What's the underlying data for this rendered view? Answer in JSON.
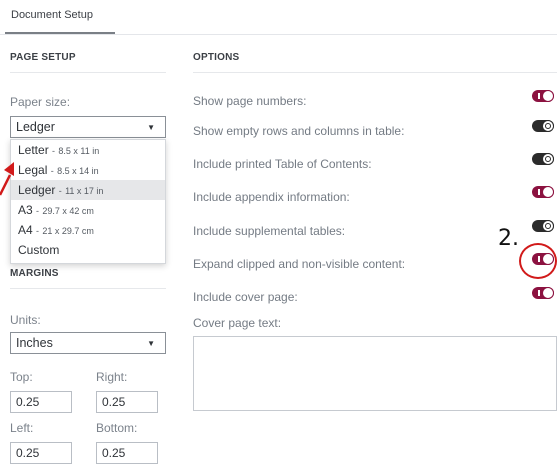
{
  "tabs": {
    "document_setup": "Document Setup"
  },
  "page_setup": {
    "heading": "PAGE SETUP",
    "paper_size_label": "Paper size:",
    "paper_size_value": "Ledger",
    "paper_options": [
      {
        "name": "Letter",
        "dims": "8.5 x 11 in"
      },
      {
        "name": "Legal",
        "dims": "8.5 x 14 in"
      },
      {
        "name": "Ledger",
        "dims": "11 x 17 in"
      },
      {
        "name": "A3",
        "dims": "29.7 x 42 cm"
      },
      {
        "name": "A4",
        "dims": "21 x 29.7 cm"
      },
      {
        "name": "Custom",
        "dims": ""
      }
    ],
    "separator": "-"
  },
  "margins": {
    "heading": "MARGINS",
    "units_label": "Units:",
    "units_value": "Inches",
    "top_label": "Top:",
    "top_value": "0.25",
    "right_label": "Right:",
    "right_value": "0.25",
    "left_label": "Left:",
    "left_value": "0.25",
    "bottom_label": "Bottom:",
    "bottom_value": "0.25"
  },
  "options": {
    "heading": "OPTIONS",
    "items": [
      {
        "label": "Show page numbers:",
        "on": true
      },
      {
        "label": "Show empty rows and columns in table:",
        "on": false
      },
      {
        "label": "Include printed Table of Contents:",
        "on": false
      },
      {
        "label": "Include appendix information:",
        "on": true
      },
      {
        "label": "Include supplemental tables:",
        "on": false
      },
      {
        "label": "Expand clipped and non-visible content:",
        "on": true
      },
      {
        "label": "Include cover page:",
        "on": true
      }
    ],
    "cover_text_label": "Cover page text:",
    "cover_text_value": ""
  },
  "annotation": {
    "number": "2."
  },
  "colors": {
    "toggle_on": "#8c1240",
    "toggle_off": "#2b2b2b",
    "annotation": "#d11a1a"
  }
}
